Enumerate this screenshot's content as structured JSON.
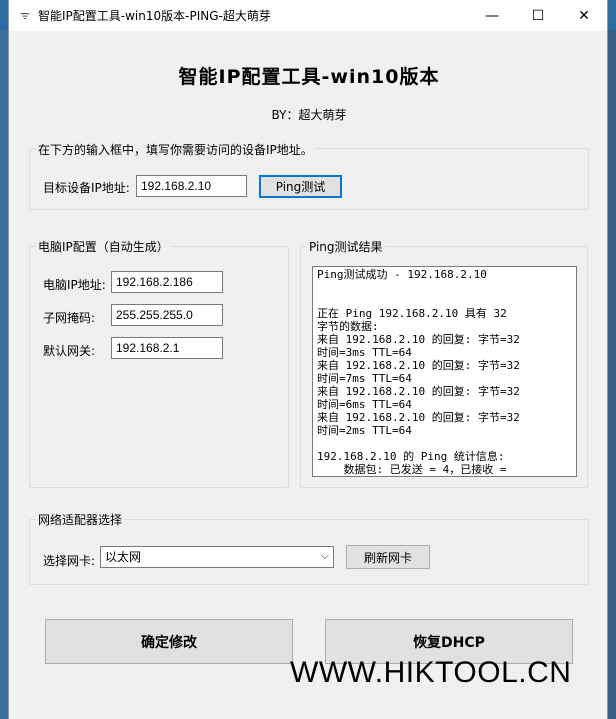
{
  "window": {
    "title": "智能IP配置工具-win10版本-PING-超大萌芽",
    "min_glyph": "—",
    "max_glyph": "☐",
    "close_glyph": "✕",
    "icon_glyph": "ᯤ"
  },
  "header": {
    "title": "智能IP配置工具-win10版本",
    "byline": "BY：超大萌芽"
  },
  "target": {
    "instruction": "在下方的输入框中，填写你需要访问的设备IP地址。",
    "ip_label": "目标设备IP地址:",
    "ip_value": "192.168.2.10",
    "ping_button": "Ping测试"
  },
  "pc_ip": {
    "group_title": "电脑IP配置（自动生成）",
    "ip_label": "电脑IP地址:",
    "ip_value": "192.168.2.186",
    "mask_label": "子网掩码:",
    "mask_value": "255.255.255.0",
    "gateway_label": "默认网关:",
    "gateway_value": "192.168.2.1"
  },
  "ping_result": {
    "group_title": "Ping测试结果",
    "lines": [
      "Ping测试成功 - 192.168.2.10",
      "",
      "",
      "正在 Ping 192.168.2.10 具有 32",
      "字节的数据:",
      "来自 192.168.2.10 的回复: 字节=32",
      "时间=3ms TTL=64",
      "来自 192.168.2.10 的回复: 字节=32",
      "时间=7ms TTL=64",
      "来自 192.168.2.10 的回复: 字节=32",
      "时间=6ms TTL=64",
      "来自 192.168.2.10 的回复: 字节=32",
      "时间=2ms TTL=64",
      "",
      "192.168.2.10 的 Ping 统计信息:",
      "    数据包: 已发送 = 4，已接收 ="
    ]
  },
  "adapter": {
    "group_title": "网络适配器选择",
    "select_label": "选择网卡:",
    "selected": "以太网",
    "refresh_button": "刷新网卡"
  },
  "actions": {
    "confirm": "确定修改",
    "restore": "恢复DHCP"
  },
  "watermark": "WWW.HIKTOOL.CN"
}
